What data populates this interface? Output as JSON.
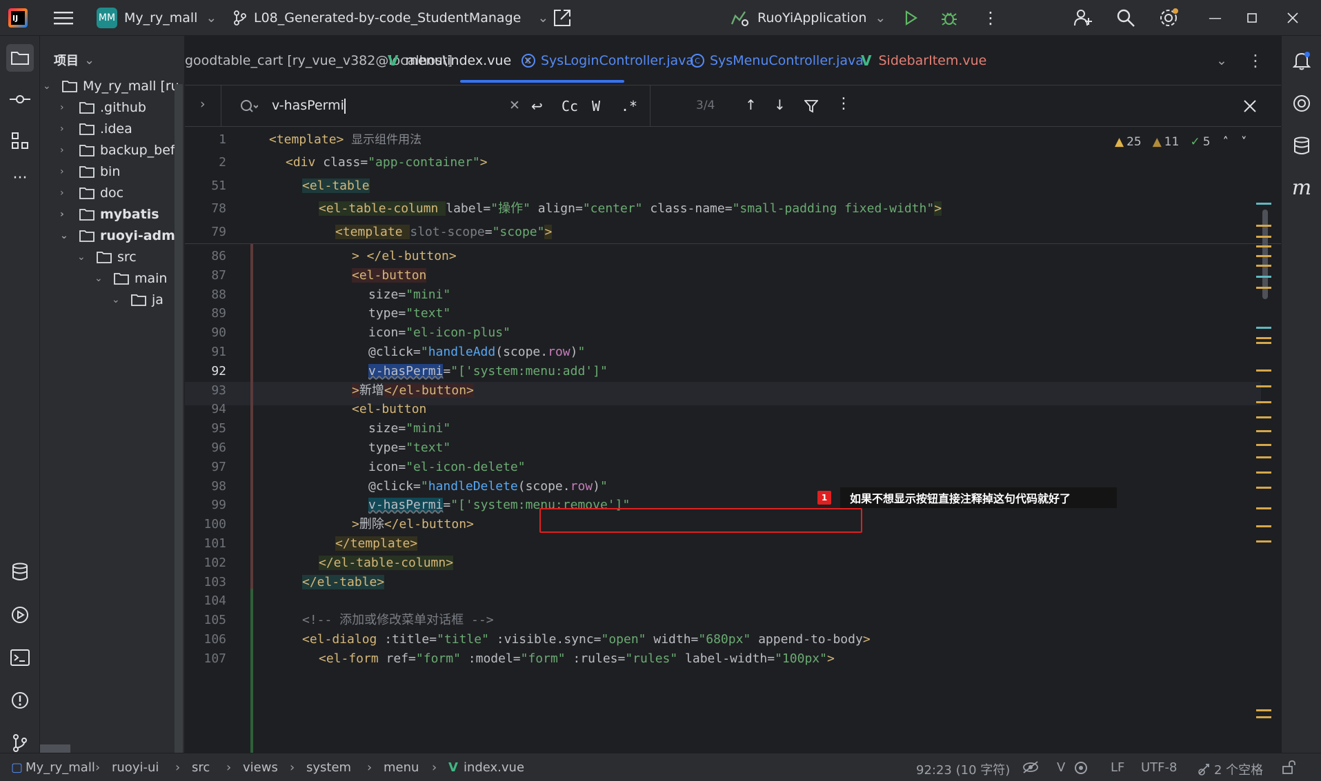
{
  "titlebar": {
    "project_badge": "MM",
    "project_name": "My_ry_mall",
    "branch": "L08_Generated-by-code_StudentManage",
    "run_config": "RuoYiApplication"
  },
  "project_panel": {
    "title": "项目",
    "tree": [
      {
        "label": "My_ry_mall [ru",
        "depth": 0,
        "expanded": true,
        "bold": false
      },
      {
        "label": ".github",
        "depth": 1,
        "expanded": false,
        "bold": false
      },
      {
        "label": ".idea",
        "depth": 1,
        "expanded": false,
        "bold": false
      },
      {
        "label": "backup_bef",
        "depth": 1,
        "expanded": false,
        "bold": false
      },
      {
        "label": "bin",
        "depth": 1,
        "expanded": false,
        "bold": false
      },
      {
        "label": "doc",
        "depth": 1,
        "expanded": false,
        "bold": false
      },
      {
        "label": "mybatis",
        "depth": 1,
        "expanded": false,
        "bold": true
      },
      {
        "label": "ruoyi-admi",
        "depth": 1,
        "expanded": true,
        "bold": true
      },
      {
        "label": "src",
        "depth": 2,
        "expanded": true,
        "bold": false
      },
      {
        "label": "main",
        "depth": 3,
        "expanded": true,
        "bold": false
      },
      {
        "label": "ja",
        "depth": 4,
        "expanded": true,
        "bold": false
      }
    ]
  },
  "tabs": [
    {
      "label": "goodtable_cart [ry_vue_v382@localhost]",
      "kind": "db",
      "color": "#bcbec4"
    },
    {
      "label": "menu\\index.vue",
      "kind": "vue",
      "color": "#dfe1e5",
      "active": true
    },
    {
      "label": "SysLoginController.java",
      "kind": "class",
      "color": "#548af7"
    },
    {
      "label": "SysMenuController.java",
      "kind": "class",
      "color": "#548af7"
    },
    {
      "label": "SidebarItem.vue",
      "kind": "vue",
      "color": "#e57f74"
    }
  ],
  "search": {
    "query": "v-hasPermi",
    "match_count": "3/4",
    "opt_case": "Cc",
    "opt_word": "W",
    "opt_regex": ".*"
  },
  "inspections": {
    "warnings": "25",
    "weak_warnings": "11",
    "ok": "5"
  },
  "callout": {
    "number": "1",
    "text": "如果不想显示按钮直接注释掉这句代码就好了"
  },
  "code": {
    "sticky_lines": [
      {
        "num": "1",
        "indent": 0,
        "parts": [
          [
            "tg",
            "<template>"
          ],
          [
            "hint",
            "  显示组件用法"
          ]
        ]
      },
      {
        "num": "2",
        "indent": 1,
        "parts": [
          [
            "tg",
            "<div "
          ],
          [
            "at",
            "class="
          ],
          [
            "st",
            "\"app-container\""
          ],
          [
            "tg",
            ">"
          ]
        ]
      },
      {
        "num": "51",
        "indent": 2,
        "parts": [
          [
            "tg",
            "<el-table"
          ]
        ]
      },
      {
        "num": "78",
        "indent": 3,
        "parts": [
          [
            "tg",
            "<el-table-column "
          ],
          [
            "at",
            "label="
          ],
          [
            "st",
            "\"操作\" "
          ],
          [
            "at",
            "align="
          ],
          [
            "st",
            "\"center\" "
          ],
          [
            "at",
            "class-name="
          ],
          [
            "st",
            "\"small-padding fixed-width\""
          ],
          [
            "tg",
            ">"
          ]
        ]
      },
      {
        "num": "79",
        "indent": 4,
        "parts": [
          [
            "tg",
            "<template "
          ],
          [
            "cm",
            "slot-scope"
          ],
          [
            "at",
            "="
          ],
          [
            "st",
            "\"scope\""
          ],
          [
            "tg",
            ">"
          ]
        ]
      }
    ],
    "lines": [
      {
        "num": "86",
        "indent": 5,
        "parts": [
          [
            "tg",
            "> </el-button>"
          ]
        ]
      },
      {
        "num": "87",
        "indent": 5,
        "parts": [
          [
            "tg",
            "<el-button"
          ]
        ]
      },
      {
        "num": "88",
        "indent": 6,
        "parts": [
          [
            "at",
            "size="
          ],
          [
            "st",
            "\"mini\""
          ]
        ]
      },
      {
        "num": "89",
        "indent": 6,
        "parts": [
          [
            "at",
            "type="
          ],
          [
            "st",
            "\"text\""
          ]
        ]
      },
      {
        "num": "90",
        "indent": 6,
        "parts": [
          [
            "at",
            "icon="
          ],
          [
            "st",
            "\"el-icon-plus\""
          ]
        ]
      },
      {
        "num": "91",
        "indent": 6,
        "parts": [
          [
            "at",
            "@click="
          ],
          [
            "st",
            "\""
          ],
          [
            "fn",
            "handleAdd"
          ],
          [
            "at",
            "(scope."
          ],
          [
            "pp",
            "row"
          ],
          [
            "at",
            ")"
          ],
          [
            "st",
            "\""
          ]
        ]
      },
      {
        "num": "92",
        "indent": 6,
        "parts": [
          [
            "at",
            "v-hasPermi"
          ],
          [
            "at",
            "="
          ],
          [
            "st",
            "\"['system:menu:add']\""
          ]
        ]
      },
      {
        "num": "93",
        "indent": 5,
        "parts": [
          [
            "tg",
            ">"
          ],
          [
            "at",
            "新增"
          ],
          [
            "tg",
            "</el-button>"
          ]
        ]
      },
      {
        "num": "94",
        "indent": 5,
        "parts": [
          [
            "tg",
            "<el-button"
          ]
        ]
      },
      {
        "num": "95",
        "indent": 6,
        "parts": [
          [
            "at",
            "size="
          ],
          [
            "st",
            "\"mini\""
          ]
        ]
      },
      {
        "num": "96",
        "indent": 6,
        "parts": [
          [
            "at",
            "type="
          ],
          [
            "st",
            "\"text\""
          ]
        ]
      },
      {
        "num": "97",
        "indent": 6,
        "parts": [
          [
            "at",
            "icon="
          ],
          [
            "st",
            "\"el-icon-delete\""
          ]
        ]
      },
      {
        "num": "98",
        "indent": 6,
        "parts": [
          [
            "at",
            "@click="
          ],
          [
            "st",
            "\""
          ],
          [
            "fn",
            "handleDelete"
          ],
          [
            "at",
            "(scope."
          ],
          [
            "pp",
            "row"
          ],
          [
            "at",
            ")"
          ],
          [
            "st",
            "\""
          ]
        ]
      },
      {
        "num": "99",
        "indent": 6,
        "parts": [
          [
            "at",
            "v-hasPermi"
          ],
          [
            "at",
            "="
          ],
          [
            "st",
            "\"['system:menu:remove']\""
          ]
        ]
      },
      {
        "num": "100",
        "indent": 5,
        "parts": [
          [
            "tg",
            ">"
          ],
          [
            "at",
            "删除"
          ],
          [
            "tg",
            "</el-button>"
          ]
        ]
      },
      {
        "num": "101",
        "indent": 4,
        "parts": [
          [
            "tg",
            "</template>"
          ]
        ]
      },
      {
        "num": "102",
        "indent": 3,
        "parts": [
          [
            "tg",
            "</el-table-column>"
          ]
        ]
      },
      {
        "num": "103",
        "indent": 2,
        "parts": [
          [
            "tg",
            "</el-table>"
          ]
        ]
      },
      {
        "num": "104",
        "indent": 0,
        "parts": []
      },
      {
        "num": "105",
        "indent": 2,
        "parts": [
          [
            "cm",
            "<!-- 添加或修改菜单对话框 -->"
          ]
        ]
      },
      {
        "num": "106",
        "indent": 2,
        "parts": [
          [
            "tg",
            "<el-dialog "
          ],
          [
            "at",
            ":title="
          ],
          [
            "st",
            "\"title\" "
          ],
          [
            "at",
            ":visible.sync="
          ],
          [
            "st",
            "\"open\" "
          ],
          [
            "at",
            "width="
          ],
          [
            "st",
            "\"680px\" "
          ],
          [
            "at",
            "append-to-body"
          ],
          [
            "tg",
            ">"
          ]
        ]
      },
      {
        "num": "107",
        "indent": 3,
        "parts": [
          [
            "tg",
            "<el-form "
          ],
          [
            "at",
            "ref="
          ],
          [
            "st",
            "\"form\" "
          ],
          [
            "at",
            ":model="
          ],
          [
            "st",
            "\"form\" "
          ],
          [
            "at",
            ":rules="
          ],
          [
            "st",
            "\"rules\" "
          ],
          [
            "at",
            "label-width="
          ],
          [
            "st",
            "\"100px\""
          ],
          [
            "tg",
            ">"
          ]
        ]
      }
    ]
  },
  "statusbar": {
    "crumbs": [
      "My_ry_mall",
      "ruoyi-ui",
      "src",
      "views",
      "system",
      "menu",
      "index.vue"
    ],
    "position": "92:23 (10 字符)",
    "line_sep": "LF",
    "encoding": "UTF-8",
    "indent": "2 个空格"
  },
  "colors": {
    "accent": "#3574f0",
    "callout_red": "#e02020",
    "warning": "#e0b34a",
    "ok": "#5fb865",
    "vue": "#41b883"
  }
}
